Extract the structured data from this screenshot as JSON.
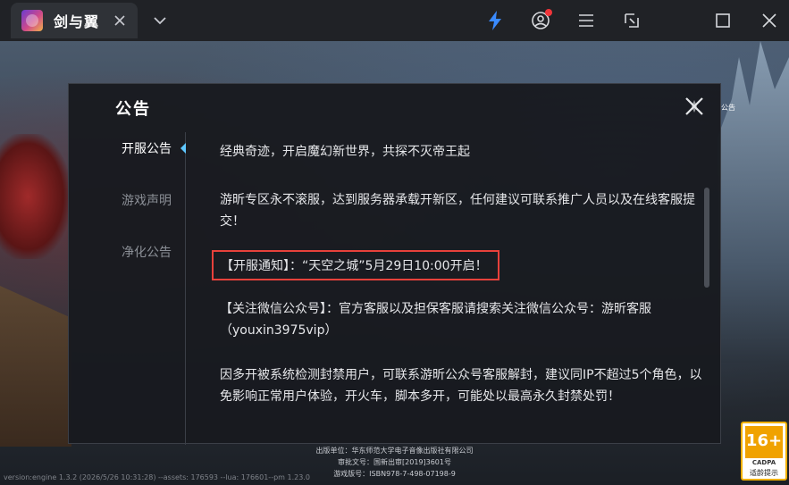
{
  "titlebar": {
    "tab_title": "剑与翼",
    "close_icon": "close-icon",
    "dropdown_icon": "chevron-down-icon",
    "buttons": [
      "lightning-icon",
      "user-icon",
      "menu-icon",
      "screenshot-icon",
      "maximize-icon",
      "close-icon"
    ],
    "accent": "#3a8bff"
  },
  "modal": {
    "title": "公告",
    "nav": [
      "开服公告",
      "游戏声明",
      "净化公告"
    ],
    "active_nav": "开服公告",
    "paragraphs": [
      "经典奇迹，开启魔幻新世界，共探不灭帝王起",
      "游昕专区永不滚服，达到服务器承载开新区，任何建议可联系推广人员以及在线客服提交！",
      "【开服通知】：“天空之城”5月29日10:00开启！",
      "【关注微信公众号】：官方客服以及担保客服请搜索关注微信公众号：游昕客服（youxin3975vip）",
      "因多开被系统检测封禁用户，可联系游昕公众号客服解封，建议同IP不超过5个角色，以免影响正常用户体验，开火车，脚本多开，可能处以最高永久封禁处罚！"
    ],
    "highlight_color": "#e8413b"
  },
  "side": {
    "announce_label": "公告"
  },
  "footer": {
    "publisher": "出版单位：华东师范大学电子音像出版社有限公司",
    "approval": "审批文号：国新出审[2019]3601号",
    "isbn": "游戏版号：ISBN978-7-498-07198-9",
    "version": "version:engine 1.3.2 (2026/5/26 10:31:28) --assets: 176593 --lua: 176601--pm 1.23.0"
  },
  "age_rating": {
    "label": "16+",
    "org": "CADPA",
    "hint": "适龄提示"
  }
}
